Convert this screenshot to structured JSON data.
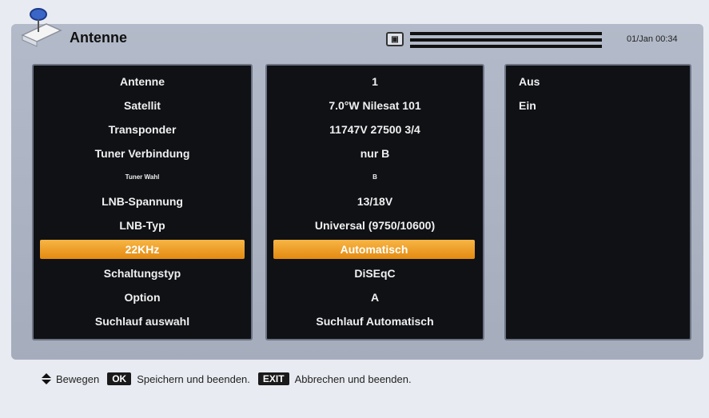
{
  "header": {
    "title": "Antenne",
    "signal_icon": "satellite-signal-icon",
    "datetime": "01/Jan 00:34"
  },
  "settings": {
    "labels": [
      "Antenne",
      "Satellit",
      "Transponder",
      "Tuner Verbindung",
      "Tuner Wahl",
      "LNB-Spannung",
      "LNB-Typ",
      "22KHz",
      "Schaltungstyp",
      "Option",
      "Suchlauf auswahl"
    ],
    "values": [
      "1",
      "7.0°W Nilesat 101",
      "11747V 27500 3/4",
      "nur B",
      "B",
      "13/18V",
      "Universal (9750/10600)",
      "Automatisch",
      "DiSEqC",
      "A",
      "Suchlauf Automatisch"
    ],
    "selected_index": 7
  },
  "options": [
    "Aus",
    "Ein"
  ],
  "footer": {
    "move_label": "Bewegen",
    "ok_key": "OK",
    "ok_label": "Speichern und beenden.",
    "exit_key": "EXIT",
    "exit_label": "Abbrechen und beenden."
  },
  "colors": {
    "highlight": "#f0a030",
    "panel_bg": "#0f1115",
    "frame_bg": "#acb3c3"
  }
}
